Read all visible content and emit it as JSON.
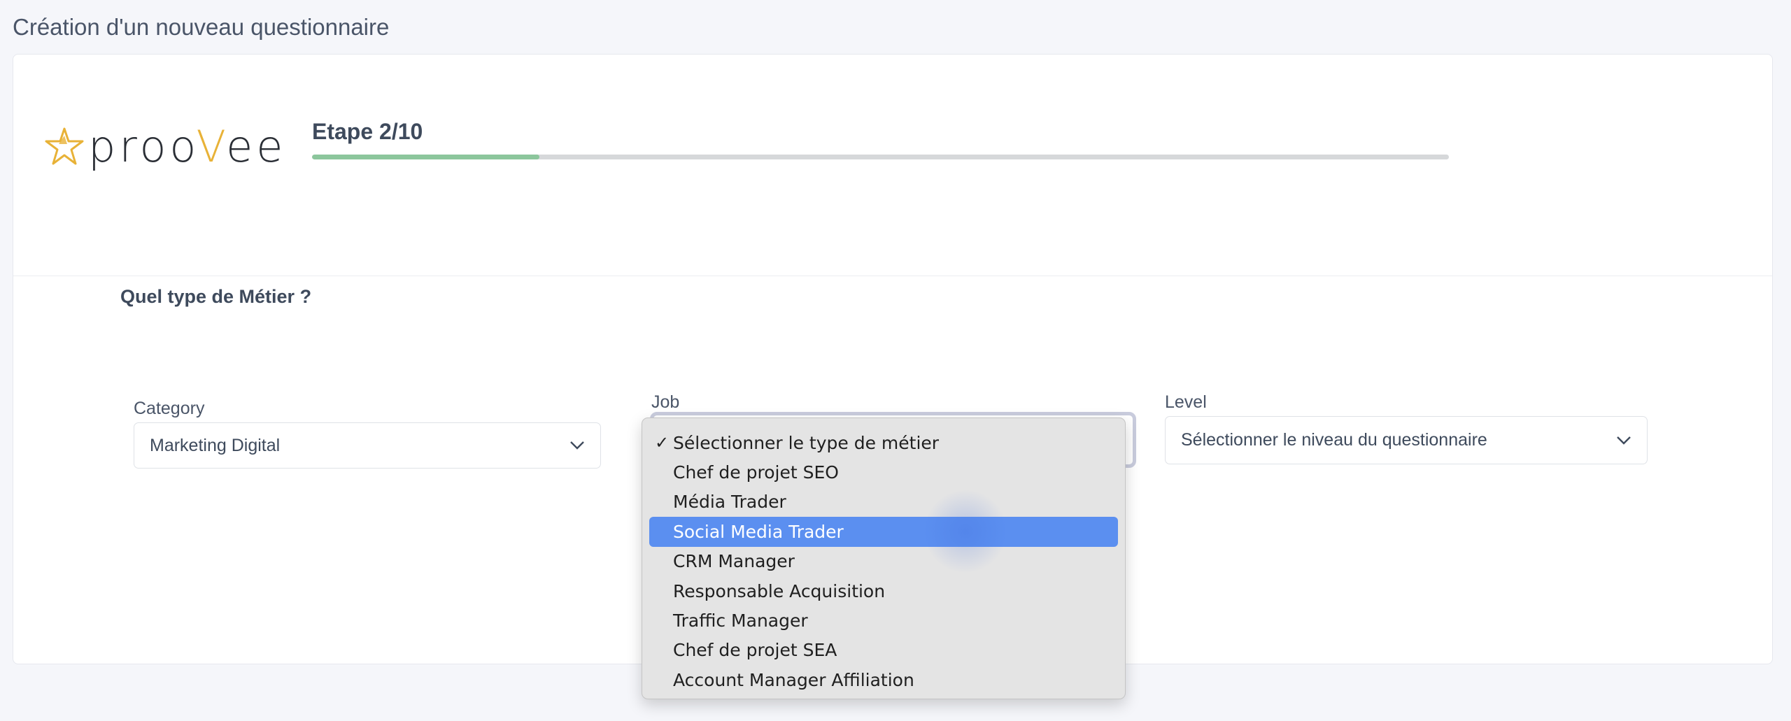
{
  "page": {
    "title": "Création d'un nouveau questionnaire"
  },
  "brand": {
    "logo_text_prefix": "proo",
    "logo_text_accent": "V",
    "logo_text_suffix": "ee",
    "accent_color": "#e8b237"
  },
  "progress": {
    "step_label": "Etape 2/10",
    "fraction": 0.2,
    "fill_color": "#8cc69c"
  },
  "form": {
    "question": "Quel type de Métier ?",
    "category": {
      "label": "Category",
      "value": "Marketing Digital"
    },
    "job": {
      "label": "Job"
    },
    "level": {
      "label": "Level",
      "value": "Sélectionner le niveau du questionnaire"
    }
  },
  "job_dropdown": {
    "checkmark": "✓",
    "options": [
      {
        "label": "Sélectionner le type de métier",
        "checked": true
      },
      {
        "label": "Chef de projet SEO"
      },
      {
        "label": "Média Trader"
      },
      {
        "label": "Social Media Trader",
        "highlighted": true
      },
      {
        "label": "CRM Manager"
      },
      {
        "label": "Responsable Acquisition"
      },
      {
        "label": "Traffic Manager"
      },
      {
        "label": "Chef de projet SEA"
      },
      {
        "label": "Account Manager Affiliation"
      }
    ],
    "highlight_color": "#5b8ff0"
  },
  "icons": {
    "select_chevron": "chevron-down-icon",
    "logo_star": "star-icon"
  }
}
